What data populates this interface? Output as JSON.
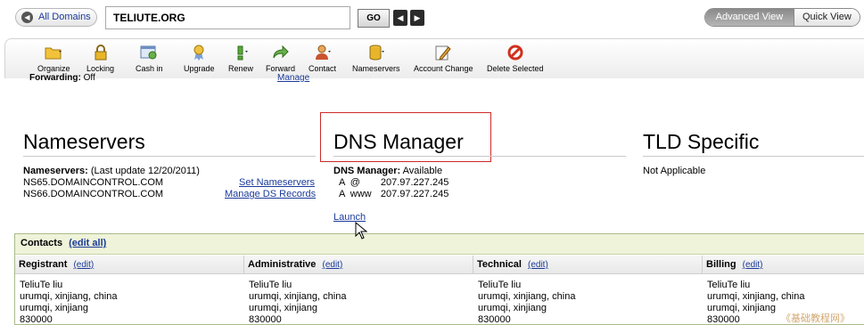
{
  "topbar": {
    "all_domains": "All Domains",
    "domain": "TELIUTE.ORG",
    "go": "GO",
    "prev": "◀",
    "next": "▶",
    "advanced_view": "Advanced View",
    "quick_view": "Quick View"
  },
  "toolbar": [
    {
      "label": "Organize",
      "icon": "folder-icon"
    },
    {
      "label": "Locking",
      "icon": "lock-icon"
    },
    {
      "label": "Cash in",
      "icon": "cash-in-icon"
    },
    {
      "label": "Upgrade",
      "icon": "ribbon-icon"
    },
    {
      "label": "Renew",
      "icon": "renew-icon"
    },
    {
      "label": "Forward",
      "icon": "forward-arrow-icon"
    },
    {
      "label": "Contact",
      "icon": "contact-person-icon"
    },
    {
      "label": "Nameservers",
      "icon": "database-icon"
    },
    {
      "label": "Account Change",
      "icon": "account-change-icon"
    },
    {
      "label": "Delete Selected",
      "icon": "delete-icon"
    }
  ],
  "forwarding": {
    "label": "Forwarding:",
    "value": "Off",
    "link": "Manage"
  },
  "nameservers": {
    "title": "Nameservers",
    "label": "Nameservers:",
    "updated": "(Last update 12/20/2011)",
    "ns1": "NS65.DOMAINCONTROL.COM",
    "ns2": "NS66.DOMAINCONTROL.COM",
    "set_link": "Set Nameservers",
    "ds_link": "Manage DS Records"
  },
  "dns": {
    "title": "DNS Manager",
    "label": "DNS Manager:",
    "status": "Available",
    "records": [
      {
        "type": "A",
        "host": "@",
        "ip": "207.97.227.245"
      },
      {
        "type": "A",
        "host": "www",
        "ip": "207.97.227.245"
      }
    ],
    "launch": "Launch"
  },
  "tld": {
    "title": "TLD Specific",
    "value": "Not Applicable"
  },
  "contacts": {
    "title": "Contacts",
    "edit_all": "(edit all)",
    "columns": [
      {
        "title": "Registrant",
        "edit": "(edit)",
        "name": "TeliuTe liu",
        "line1": "urumqi, xinjiang, china",
        "line2": "urumqi, xinjiang",
        "zip": "830000"
      },
      {
        "title": "Administrative",
        "edit": "(edit)",
        "name": "TeliuTe liu",
        "line1": "urumqi, xinjiang, china",
        "line2": "urumqi, xinjiang",
        "zip": "830000"
      },
      {
        "title": "Technical",
        "edit": "(edit)",
        "name": "TeliuTe liu",
        "line1": "urumqi, xinjiang, china",
        "line2": "urumqi, xinjiang",
        "zip": "830000"
      },
      {
        "title": "Billing",
        "edit": "(edit)",
        "name": "TeliuTe liu",
        "line1": "urumqi, xinjiang, china",
        "line2": "urumqi, xinjiang",
        "zip": "830000"
      }
    ]
  },
  "watermark": "《基础教程网》"
}
